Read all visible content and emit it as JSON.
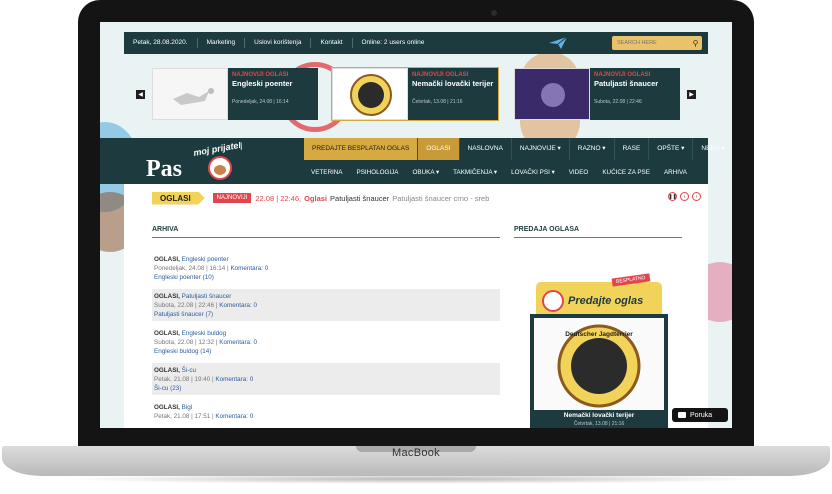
{
  "topbar": {
    "date": "Petak, 28.08.2020.",
    "links": [
      "Marketing",
      "Uslovi korištenja",
      "Kontakt"
    ],
    "online": "Online: 2 users online",
    "search_placeholder": "SEARCH HERE"
  },
  "slider": [
    {
      "category": "NAJNOVIJI OGLASI",
      "title": "Engleski poenter",
      "date": "Ponedeljak, 24.08 | 16:14"
    },
    {
      "category": "NAJNOVIJI OGLASI",
      "title": "Nemački lovački terijer",
      "date": "Četvrtak, 13.08 | 21:16"
    },
    {
      "category": "NAJNOVIJI OGLASI",
      "title": "Patuljasti šnaucer",
      "date": "Subota, 22.08 | 22:46"
    }
  ],
  "logo": {
    "main": "Pas",
    "sub": "moj prijatelj"
  },
  "nav_top": [
    {
      "label": "PREDAJTE BESPLATAN OGLAS",
      "style": "gold"
    },
    {
      "label": "OGLASI",
      "style": "sel"
    },
    {
      "label": "NASLOVNA",
      "style": ""
    },
    {
      "label": "NAJNOVIJE ▾",
      "style": ""
    },
    {
      "label": "RAZNO ▾",
      "style": ""
    },
    {
      "label": "RASE",
      "style": ""
    },
    {
      "label": "OPŠTE ▾",
      "style": ""
    },
    {
      "label": "NEGA ▾",
      "style": ""
    }
  ],
  "nav_bottom": [
    "VETERINA",
    "PSIHOLOGIJA",
    "OBUKA ▾",
    "TAKMIČENJA ▾",
    "LOVAČKI PSI ▾",
    "VIDEO",
    "KUĆICE ZA PSE",
    "ARHIVA"
  ],
  "ticker": {
    "tag": "OGLASI",
    "badge": "NAJNOVIJI",
    "time": "22.08 | 22:46,",
    "category": "Oglasi",
    "title": "Patuljasti šnaucer",
    "desc": "Patuljasti šnaucer crno - sreb"
  },
  "archive": {
    "heading": "ARHIVA",
    "rows": [
      {
        "cat": "OGLASI,",
        "title": "Engleski poenter",
        "meta": "Ponedeljak, 24.08 | 16:14 |",
        "comments": "Komentara: 0",
        "count": "Engleski poenter (10)"
      },
      {
        "cat": "OGLASI,",
        "title": "Patuljasti šnaucer",
        "meta": "Subota, 22.08 | 22:46 |",
        "comments": "Komentara: 0",
        "count": "Patuljasti šnaucer (7)"
      },
      {
        "cat": "OGLASI,",
        "title": "Engleski buldog",
        "meta": "Subota, 22.08 | 12:32 |",
        "comments": "Komentara: 0",
        "count": "Engleski buldog (14)"
      },
      {
        "cat": "OGLASI,",
        "title": "Ši-cu",
        "meta": "Petak, 21.08 | 19:40 |",
        "comments": "Komentara: 0",
        "count": "Ši-cu (23)"
      },
      {
        "cat": "OGLASI,",
        "title": "Bigl",
        "meta": "Petak, 21.08 | 17:51 |",
        "comments": "Komentara: 0",
        "count": ""
      }
    ]
  },
  "ads": {
    "heading": "PREDAJA OGLASA",
    "banner_badge": "BESPLATNO",
    "banner_text": "Predajte oglas",
    "featured_title": "Nemački lovački terijer",
    "featured_date": "Četvrtak, 13.08 | 21:16",
    "featured_img_text": "Deutscher Jagdterrier"
  },
  "chat": {
    "label": "Poruka"
  },
  "device": {
    "label": "MacBook"
  },
  "colors": {
    "dark_teal": "#1d3b3f",
    "gold": "#d7a941",
    "red": "#e0464c",
    "yellow": "#f2d35a",
    "link": "#2a5d9a"
  }
}
